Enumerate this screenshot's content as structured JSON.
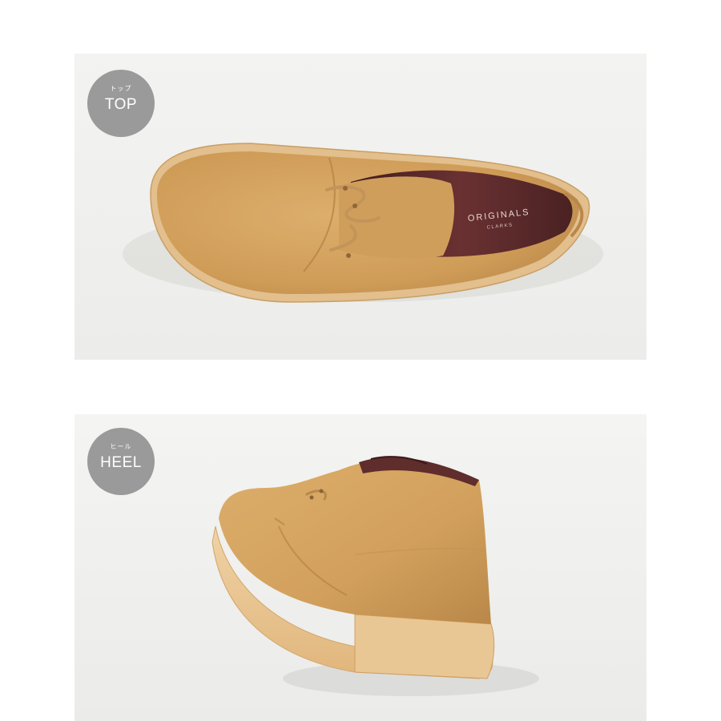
{
  "panels": [
    {
      "id": "top",
      "badge_kana": "トップ",
      "badge_label": "TOP",
      "insole_text_main": "ORIGINALS",
      "insole_text_sub": "CLARKS"
    },
    {
      "id": "heel",
      "badge_kana": "ヒール",
      "badge_label": "HEEL"
    }
  ],
  "colors": {
    "badge": "#9a9a9a",
    "suede": "#d4a35f",
    "sole": "#e8c99a",
    "lining": "#5a2a2a"
  }
}
